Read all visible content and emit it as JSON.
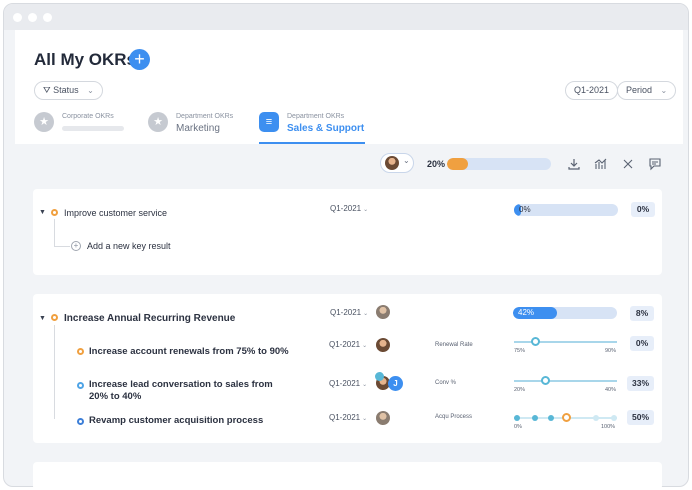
{
  "header": {
    "title": "All My OKRs",
    "add_icon": "plus-icon",
    "status_filter": "Status",
    "period_value": "Q1-2021",
    "period_select": "Period"
  },
  "tabs": [
    {
      "sub": "Corporate OKRs",
      "main": "",
      "icon": "star-icon"
    },
    {
      "sub": "Department OKRs",
      "main": "Marketing",
      "icon": "star-icon"
    },
    {
      "sub": "Department OKRs",
      "main": "Sales & Support",
      "icon": "document-icon"
    }
  ],
  "toolbar": {
    "overall_progress_label": "20%",
    "overall_progress": 0.2,
    "icons": [
      "download-icon",
      "chart-icon",
      "collapse-icon",
      "comment-icon"
    ]
  },
  "okr1": {
    "title": "Improve customer service",
    "period": "Q1-2021",
    "progress_label": "0%",
    "progress": 0.0,
    "pct": "0%",
    "add_kr": "Add a new key result"
  },
  "okr2": {
    "title": "Increase Annual Recurring Revenue",
    "period": "Q1-2021",
    "progress_label": "42%",
    "progress": 0.42,
    "pct": "8%",
    "krs": [
      {
        "title": "Increase account renewals from 75% to 90%",
        "period": "Q1-2021",
        "metric": "Renewal Rate",
        "min": "75%",
        "max": "90%",
        "level": 0.2,
        "pct": "0%"
      },
      {
        "title": "Increase lead conversation to sales from 20% to 40%",
        "period": "Q1-2021",
        "metric": "Conv %",
        "min": "20%",
        "max": "40%",
        "level": 0.3,
        "pct": "33%",
        "owner_initial": "J"
      },
      {
        "title": "Revamp customer acquisition process",
        "period": "Q1-2021",
        "metric": "Acqu Process",
        "min": "0%",
        "max": "100%",
        "level": 0.5,
        "pct": "50%"
      }
    ]
  },
  "colors": {
    "accent": "#3d8ff0",
    "warning": "#f0a040",
    "track": "#d7e3f5",
    "slider": "#58b7d6"
  }
}
